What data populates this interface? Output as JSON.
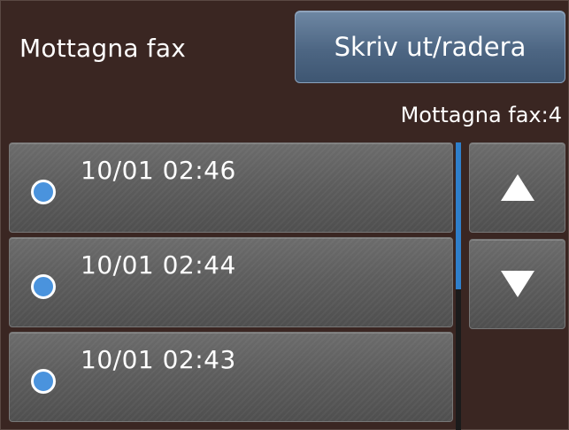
{
  "header": {
    "title": "Mottagna fax",
    "print_button_label": "Skriv ut/radera",
    "count_label": "Mottagna fax:4"
  },
  "colors": {
    "background": "#3a2622",
    "accent_button": "#4d6683",
    "status_dot": "#4a93dd",
    "scroll_thumb": "#2f7fcb"
  },
  "list": {
    "items": [
      {
        "label": "10/01 02:46"
      },
      {
        "label": "10/01 02:44"
      },
      {
        "label": "10/01 02:43"
      }
    ]
  },
  "nav": {
    "up_icon": "triangle-up",
    "down_icon": "triangle-down"
  }
}
